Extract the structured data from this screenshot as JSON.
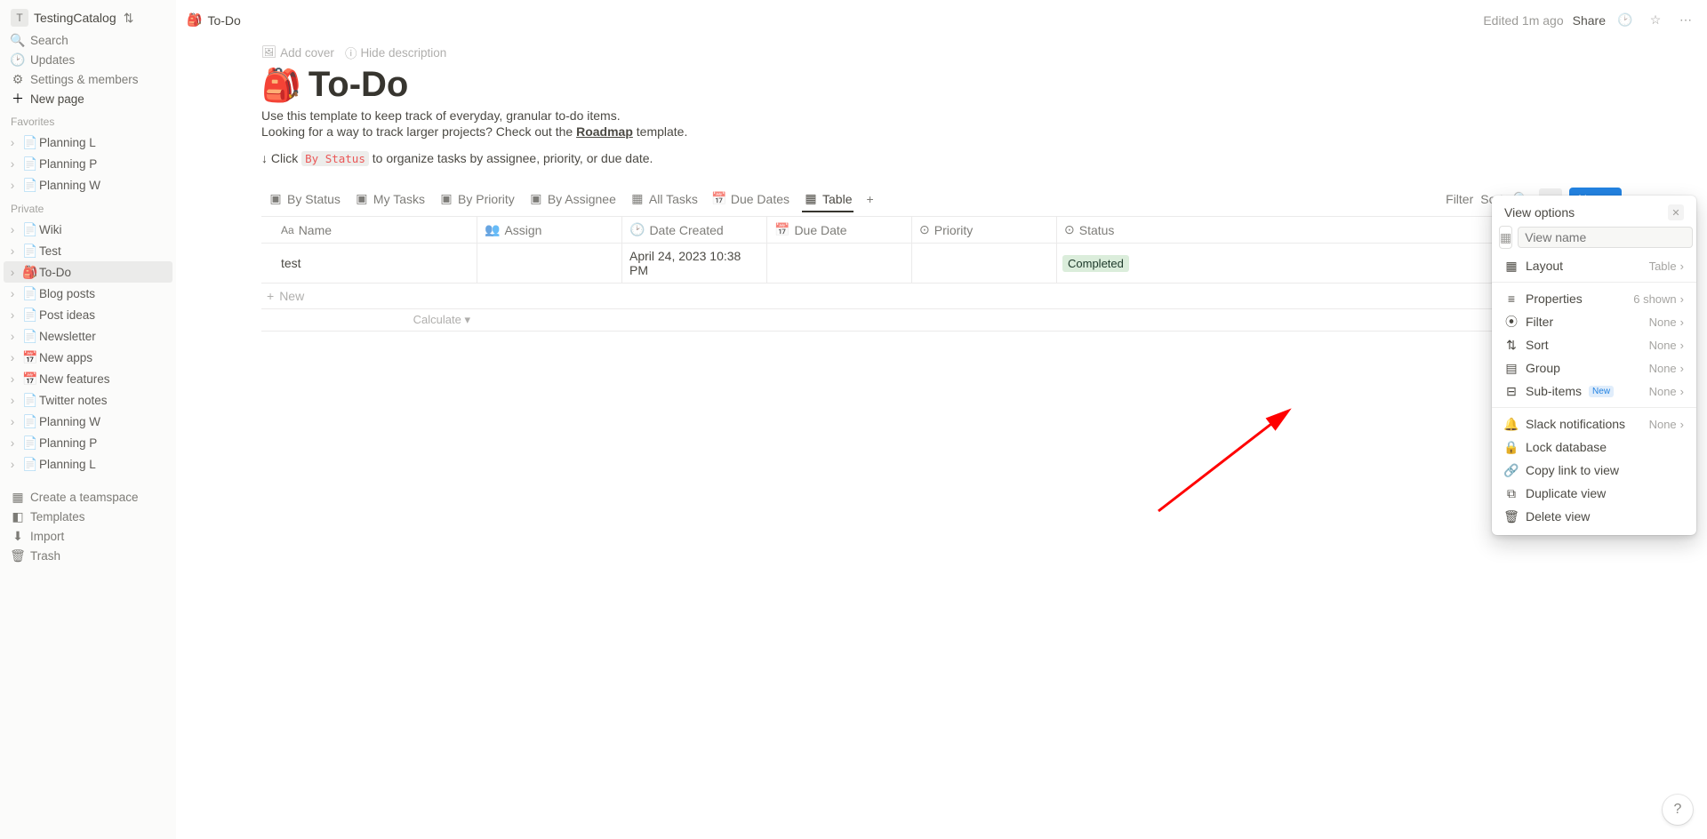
{
  "workspace": {
    "initial": "T",
    "name": "TestingCatalog"
  },
  "sidebar": {
    "search": "Search",
    "updates": "Updates",
    "settings": "Settings & members",
    "newpage": "New page",
    "favorites_label": "Favorites",
    "favorites": [
      {
        "label": "Planning L"
      },
      {
        "label": "Planning P"
      },
      {
        "label": "Planning W"
      }
    ],
    "private_label": "Private",
    "private": [
      {
        "label": "Wiki",
        "emoji": ""
      },
      {
        "label": "Test",
        "emoji": ""
      },
      {
        "label": "To-Do",
        "emoji": "🎒",
        "active": true
      },
      {
        "label": "Blog posts",
        "emoji": ""
      },
      {
        "label": "Post ideas",
        "emoji": ""
      },
      {
        "label": "Newsletter",
        "emoji": ""
      },
      {
        "label": "New apps",
        "emoji": "📅"
      },
      {
        "label": "New features",
        "emoji": "📅"
      },
      {
        "label": "Twitter notes",
        "emoji": ""
      },
      {
        "label": "Planning W",
        "emoji": ""
      },
      {
        "label": "Planning P",
        "emoji": ""
      },
      {
        "label": "Planning L",
        "emoji": ""
      }
    ],
    "teamspace": "Create a teamspace",
    "templates": "Templates",
    "import": "Import",
    "trash": "Trash"
  },
  "breadcrumb": {
    "emoji": "🎒",
    "title": "To-Do"
  },
  "top": {
    "edited": "Edited 1m ago",
    "share": "Share"
  },
  "cover": {
    "add": "Add cover",
    "hide": "Hide description"
  },
  "page": {
    "emoji": "🎒",
    "title": "To-Do",
    "desc1": "Use this template to keep track of everyday, granular to-do items.",
    "desc2a": "Looking for a way to track larger projects? Check out the ",
    "desc2link": "Roadmap",
    "desc2b": " template.",
    "desc3a": "↓ Click ",
    "desc3code": "By Status",
    "desc3b": " to organize tasks by assignee, priority, or due date."
  },
  "tabs": {
    "items": [
      {
        "label": "By Status"
      },
      {
        "label": "My Tasks"
      },
      {
        "label": "By Priority"
      },
      {
        "label": "By Assignee"
      },
      {
        "label": "All Tasks"
      },
      {
        "label": "Due Dates"
      },
      {
        "label": "Table",
        "active": true
      }
    ],
    "filter": "Filter",
    "sort": "Sort",
    "newbtn": "New"
  },
  "table": {
    "cols": {
      "name": "Name",
      "assign": "Assign",
      "created": "Date Created",
      "due": "Due Date",
      "prio": "Priority",
      "status": "Status"
    },
    "row": {
      "name": "test",
      "created": "April 24, 2023 10:38 PM",
      "status": "Completed"
    },
    "newrow": "New",
    "calc": "Calculate"
  },
  "popover": {
    "title": "View options",
    "placeholder": "View name",
    "rows": {
      "layout": {
        "label": "Layout",
        "value": "Table"
      },
      "properties": {
        "label": "Properties",
        "value": "6 shown"
      },
      "filter": {
        "label": "Filter",
        "value": "None"
      },
      "sort": {
        "label": "Sort",
        "value": "None"
      },
      "group": {
        "label": "Group",
        "value": "None"
      },
      "subitems": {
        "label": "Sub-items",
        "value": "None",
        "tag": "New"
      },
      "slack": {
        "label": "Slack notifications",
        "value": "None"
      },
      "lock": {
        "label": "Lock database"
      },
      "copy": {
        "label": "Copy link to view"
      },
      "dup": {
        "label": "Duplicate view"
      },
      "del": {
        "label": "Delete view"
      }
    }
  }
}
